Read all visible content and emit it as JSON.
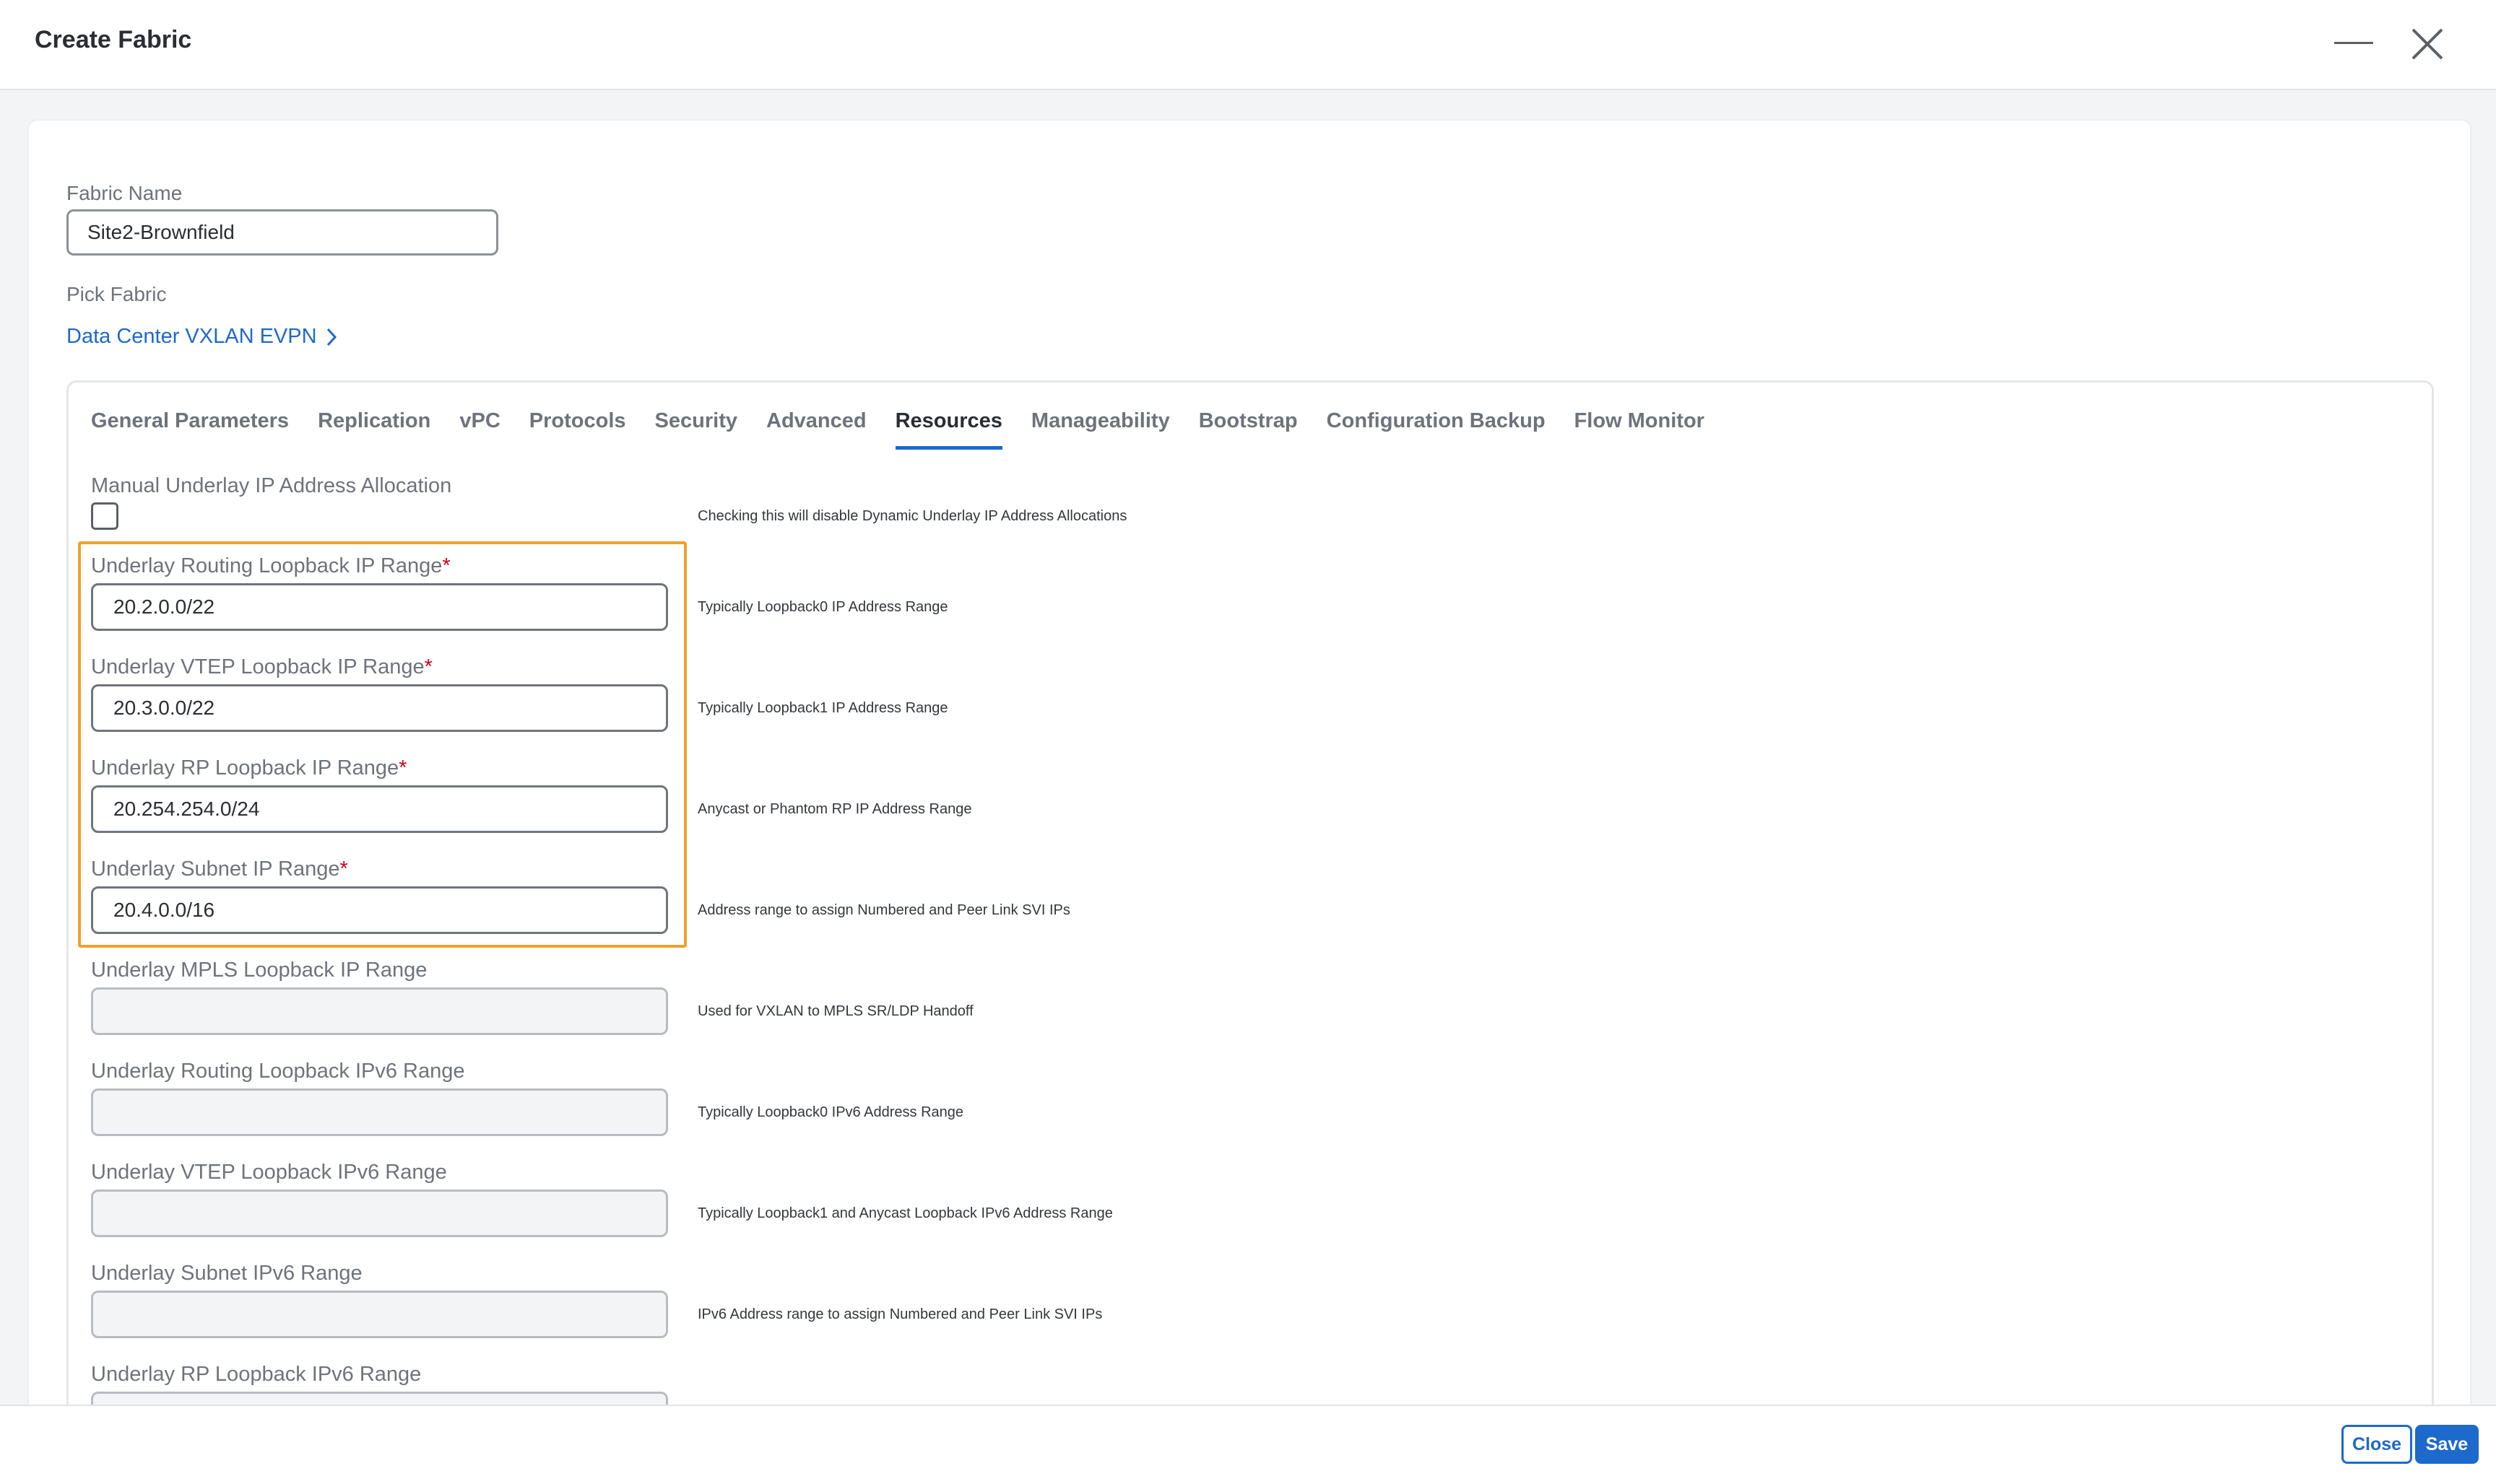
{
  "header": {
    "title": "Create Fabric",
    "minimize_icon": "minimize-icon",
    "close_icon": "close-icon"
  },
  "form": {
    "fabric_name_label": "Fabric Name",
    "fabric_name_value": "Site2-Brownfield",
    "pick_fabric_label": "Pick Fabric",
    "pick_fabric_value": "Data Center VXLAN EVPN"
  },
  "tabs": [
    {
      "label": "General Parameters",
      "active": false
    },
    {
      "label": "Replication",
      "active": false
    },
    {
      "label": "vPC",
      "active": false
    },
    {
      "label": "Protocols",
      "active": false
    },
    {
      "label": "Security",
      "active": false
    },
    {
      "label": "Advanced",
      "active": false
    },
    {
      "label": "Resources",
      "active": true
    },
    {
      "label": "Manageability",
      "active": false
    },
    {
      "label": "Bootstrap",
      "active": false
    },
    {
      "label": "Configuration Backup",
      "active": false
    },
    {
      "label": "Flow Monitor",
      "active": false
    }
  ],
  "resources": {
    "manual_alloc_label": "Manual Underlay IP Address Allocation",
    "manual_alloc_checked": false,
    "manual_alloc_help": "Checking this will disable Dynamic Underlay IP Address Allocations",
    "fields": [
      {
        "label": "Underlay Routing Loopback IP Range",
        "required": "*",
        "value": "20.2.0.0/22",
        "help": "Typically Loopback0 IP Address Range"
      },
      {
        "label": "Underlay VTEP Loopback IP Range",
        "required": "*",
        "value": "20.3.0.0/22",
        "help": "Typically Loopback1 IP Address Range"
      },
      {
        "label": "Underlay RP Loopback IP Range",
        "required": "*",
        "value": "20.254.254.0/24",
        "help": "Anycast or Phantom RP IP Address Range"
      },
      {
        "label": "Underlay Subnet IP Range",
        "required": "*",
        "value": "20.4.0.0/16",
        "help": "Address range to assign Numbered and Peer Link SVI IPs"
      },
      {
        "label": "Underlay MPLS Loopback IP Range",
        "required": "",
        "value": "",
        "help": "Used for VXLAN to MPLS SR/LDP Handoff"
      },
      {
        "label": "Underlay Routing Loopback IPv6 Range",
        "required": "",
        "value": "",
        "help": "Typically Loopback0 IPv6 Address Range"
      },
      {
        "label": "Underlay VTEP Loopback IPv6 Range",
        "required": "",
        "value": "",
        "help": "Typically Loopback1 and Anycast Loopback IPv6 Address Range"
      },
      {
        "label": "Underlay Subnet IPv6 Range",
        "required": "",
        "value": "",
        "help": "IPv6 Address range to assign Numbered and Peer Link SVI IPs"
      },
      {
        "label": "Underlay RP Loopback IPv6 Range",
        "required": "",
        "value": "",
        "help": ""
      }
    ]
  },
  "footer": {
    "close_label": "Close",
    "save_label": "Save"
  },
  "colors": {
    "accent": "#1d69cc",
    "highlight": "#f0a030",
    "required": "#d0021b"
  }
}
